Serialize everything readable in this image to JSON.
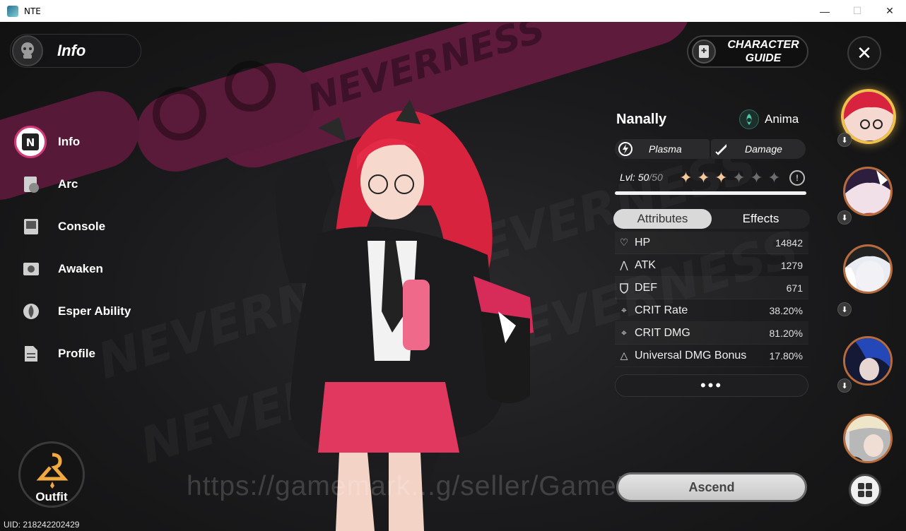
{
  "window": {
    "title": "NTE",
    "controls": [
      "—",
      "☐",
      "✕"
    ]
  },
  "header": {
    "title": "Info"
  },
  "nav": {
    "items": [
      {
        "label": "Info",
        "icon": "info-n-icon",
        "active": true
      },
      {
        "label": "Arc",
        "icon": "arc-icon"
      },
      {
        "label": "Console",
        "icon": "console-icon"
      },
      {
        "label": "Awaken",
        "icon": "awaken-icon"
      },
      {
        "label": "Esper Ability",
        "icon": "esper-ability-icon"
      },
      {
        "label": "Profile",
        "icon": "profile-icon"
      }
    ]
  },
  "outfit": {
    "label": "Outfit"
  },
  "uid": "UID: 218242202429",
  "watermark": "https://gamemark...g/seller/GameNa...",
  "guide": {
    "label_line1": "CHARACTER",
    "label_line2": "GUIDE"
  },
  "character": {
    "name": "Nanally",
    "element": "Anima",
    "tags": [
      "Plasma",
      "Damage"
    ],
    "level_label": "Lvl:",
    "level": "50",
    "level_max": "/50",
    "stars_filled": 3,
    "stars_total": 6,
    "xp_fraction": 1.0
  },
  "tabs": [
    "Attributes",
    "Effects"
  ],
  "stats": [
    {
      "label": "HP",
      "value": "14842",
      "icon": "heart-icon"
    },
    {
      "label": "ATK",
      "value": "1279",
      "icon": "atk-icon"
    },
    {
      "label": "DEF",
      "value": "671",
      "icon": "shield-icon"
    },
    {
      "label": "CRIT Rate",
      "value": "38.20%",
      "icon": "crosshair-icon"
    },
    {
      "label": "CRIT DMG",
      "value": "81.20%",
      "icon": "crit-dmg-icon"
    },
    {
      "label": "Universal DMG Bonus",
      "value": "17.80%",
      "icon": "triangle-icon"
    }
  ],
  "more_label": "•••",
  "ascend_label": "Ascend",
  "colors": {
    "accent": "#d33a78",
    "star_on": "#f6c79a",
    "band": "#5e1b3c",
    "selected_ring": "#f0c04a"
  }
}
